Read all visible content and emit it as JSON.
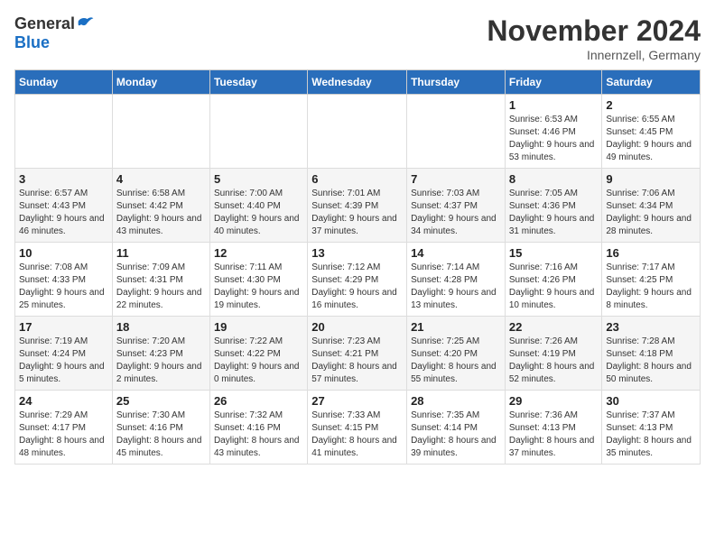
{
  "logo": {
    "general": "General",
    "blue": "Blue"
  },
  "title": "November 2024",
  "subtitle": "Innernzell, Germany",
  "headers": [
    "Sunday",
    "Monday",
    "Tuesday",
    "Wednesday",
    "Thursday",
    "Friday",
    "Saturday"
  ],
  "rows": [
    [
      {
        "day": "",
        "info": ""
      },
      {
        "day": "",
        "info": ""
      },
      {
        "day": "",
        "info": ""
      },
      {
        "day": "",
        "info": ""
      },
      {
        "day": "",
        "info": ""
      },
      {
        "day": "1",
        "info": "Sunrise: 6:53 AM\nSunset: 4:46 PM\nDaylight: 9 hours and 53 minutes."
      },
      {
        "day": "2",
        "info": "Sunrise: 6:55 AM\nSunset: 4:45 PM\nDaylight: 9 hours and 49 minutes."
      }
    ],
    [
      {
        "day": "3",
        "info": "Sunrise: 6:57 AM\nSunset: 4:43 PM\nDaylight: 9 hours and 46 minutes."
      },
      {
        "day": "4",
        "info": "Sunrise: 6:58 AM\nSunset: 4:42 PM\nDaylight: 9 hours and 43 minutes."
      },
      {
        "day": "5",
        "info": "Sunrise: 7:00 AM\nSunset: 4:40 PM\nDaylight: 9 hours and 40 minutes."
      },
      {
        "day": "6",
        "info": "Sunrise: 7:01 AM\nSunset: 4:39 PM\nDaylight: 9 hours and 37 minutes."
      },
      {
        "day": "7",
        "info": "Sunrise: 7:03 AM\nSunset: 4:37 PM\nDaylight: 9 hours and 34 minutes."
      },
      {
        "day": "8",
        "info": "Sunrise: 7:05 AM\nSunset: 4:36 PM\nDaylight: 9 hours and 31 minutes."
      },
      {
        "day": "9",
        "info": "Sunrise: 7:06 AM\nSunset: 4:34 PM\nDaylight: 9 hours and 28 minutes."
      }
    ],
    [
      {
        "day": "10",
        "info": "Sunrise: 7:08 AM\nSunset: 4:33 PM\nDaylight: 9 hours and 25 minutes."
      },
      {
        "day": "11",
        "info": "Sunrise: 7:09 AM\nSunset: 4:31 PM\nDaylight: 9 hours and 22 minutes."
      },
      {
        "day": "12",
        "info": "Sunrise: 7:11 AM\nSunset: 4:30 PM\nDaylight: 9 hours and 19 minutes."
      },
      {
        "day": "13",
        "info": "Sunrise: 7:12 AM\nSunset: 4:29 PM\nDaylight: 9 hours and 16 minutes."
      },
      {
        "day": "14",
        "info": "Sunrise: 7:14 AM\nSunset: 4:28 PM\nDaylight: 9 hours and 13 minutes."
      },
      {
        "day": "15",
        "info": "Sunrise: 7:16 AM\nSunset: 4:26 PM\nDaylight: 9 hours and 10 minutes."
      },
      {
        "day": "16",
        "info": "Sunrise: 7:17 AM\nSunset: 4:25 PM\nDaylight: 9 hours and 8 minutes."
      }
    ],
    [
      {
        "day": "17",
        "info": "Sunrise: 7:19 AM\nSunset: 4:24 PM\nDaylight: 9 hours and 5 minutes."
      },
      {
        "day": "18",
        "info": "Sunrise: 7:20 AM\nSunset: 4:23 PM\nDaylight: 9 hours and 2 minutes."
      },
      {
        "day": "19",
        "info": "Sunrise: 7:22 AM\nSunset: 4:22 PM\nDaylight: 9 hours and 0 minutes."
      },
      {
        "day": "20",
        "info": "Sunrise: 7:23 AM\nSunset: 4:21 PM\nDaylight: 8 hours and 57 minutes."
      },
      {
        "day": "21",
        "info": "Sunrise: 7:25 AM\nSunset: 4:20 PM\nDaylight: 8 hours and 55 minutes."
      },
      {
        "day": "22",
        "info": "Sunrise: 7:26 AM\nSunset: 4:19 PM\nDaylight: 8 hours and 52 minutes."
      },
      {
        "day": "23",
        "info": "Sunrise: 7:28 AM\nSunset: 4:18 PM\nDaylight: 8 hours and 50 minutes."
      }
    ],
    [
      {
        "day": "24",
        "info": "Sunrise: 7:29 AM\nSunset: 4:17 PM\nDaylight: 8 hours and 48 minutes."
      },
      {
        "day": "25",
        "info": "Sunrise: 7:30 AM\nSunset: 4:16 PM\nDaylight: 8 hours and 45 minutes."
      },
      {
        "day": "26",
        "info": "Sunrise: 7:32 AM\nSunset: 4:16 PM\nDaylight: 8 hours and 43 minutes."
      },
      {
        "day": "27",
        "info": "Sunrise: 7:33 AM\nSunset: 4:15 PM\nDaylight: 8 hours and 41 minutes."
      },
      {
        "day": "28",
        "info": "Sunrise: 7:35 AM\nSunset: 4:14 PM\nDaylight: 8 hours and 39 minutes."
      },
      {
        "day": "29",
        "info": "Sunrise: 7:36 AM\nSunset: 4:13 PM\nDaylight: 8 hours and 37 minutes."
      },
      {
        "day": "30",
        "info": "Sunrise: 7:37 AM\nSunset: 4:13 PM\nDaylight: 8 hours and 35 minutes."
      }
    ]
  ]
}
